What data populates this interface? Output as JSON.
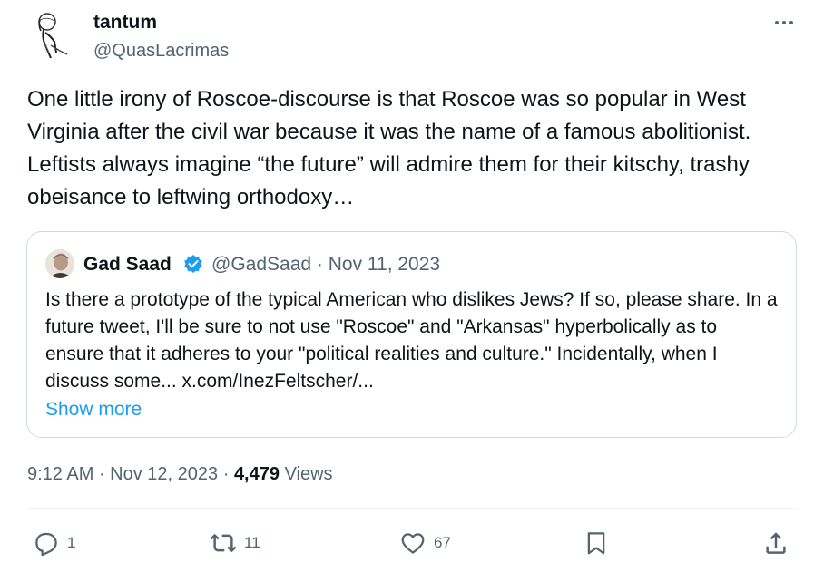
{
  "tweet": {
    "author_name": "tantum",
    "author_handle": "@QuasLacrimas",
    "text": "One little irony of Roscoe-discourse is that Roscoe was so popular in West Virginia after the civil war because it was the name of a famous abolitionist. Leftists always imagine “the future” will admire them for their kitschy, trashy obeisance to leftwing orthodoxy…",
    "time": "9:12 AM",
    "date": "Nov 12, 2023",
    "views_count": "4,479",
    "views_label": "Views",
    "more_icon": "more-horizontal-icon"
  },
  "quote": {
    "author_name": "Gad Saad",
    "author_handle": "@GadSaad",
    "date": "Nov 11, 2023",
    "verified_color": "#1d9bf0",
    "text": "Is there a prototype of the typical American who dislikes Jews?  If so, please share.  In a future tweet, I'll be sure to not use \"Roscoe\" and \"Arkansas\" hyperbolically as to ensure that it adheres to your \"political realities and culture.\"   Incidentally, when I discuss some... x.com/InezFeltscher/...",
    "show_more": "Show more"
  },
  "actions": {
    "replies": "1",
    "reposts": "11",
    "likes": "67",
    "reply_icon": "reply-icon",
    "repost_icon": "repost-icon",
    "like_icon": "heart-icon",
    "bookmark_icon": "bookmark-icon",
    "share_icon": "share-icon"
  },
  "colors": {
    "text": "#0f1419",
    "secondary": "#536471",
    "link": "#1d9bf0",
    "border": "#cfd9de"
  }
}
